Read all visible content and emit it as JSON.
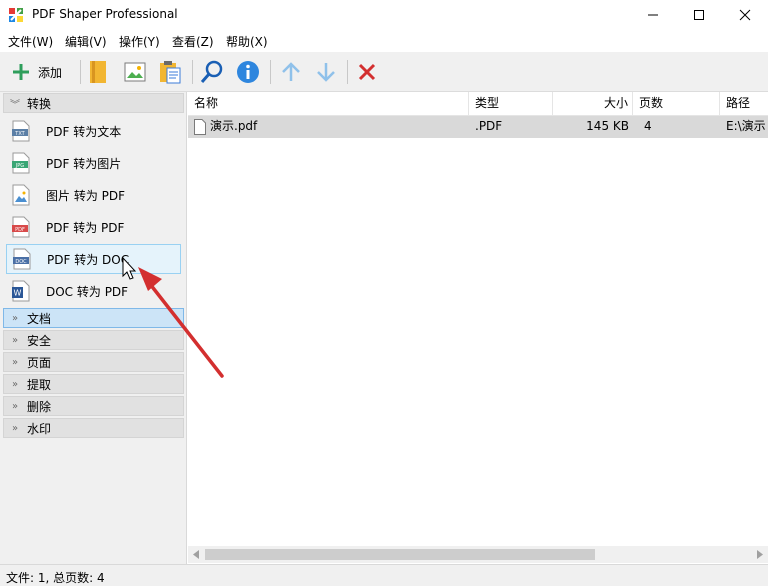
{
  "window": {
    "title": "PDF Shaper Professional",
    "minimize_icon": "minimize-icon",
    "maximize_icon": "maximize-icon",
    "close_icon": "close-icon"
  },
  "menu": [
    "文件(W)",
    "编辑(V)",
    "操作(Y)",
    "查看(Z)",
    "帮助(X)"
  ],
  "toolbar": {
    "add_label": "添加",
    "icons": [
      "plus-icon",
      "bookmark-icon",
      "image-icon",
      "clipboard-icon",
      "search-icon",
      "info-icon",
      "arrow-up-icon",
      "arrow-down-icon",
      "delete-icon"
    ]
  },
  "sidebar": {
    "open_section": "转换",
    "items": [
      {
        "label": "PDF 转为文本",
        "icon": "txt-file-icon",
        "badge": "TXT"
      },
      {
        "label": "PDF 转为图片",
        "icon": "jpg-file-icon",
        "badge": "JPG"
      },
      {
        "label": "图片 转为 PDF",
        "icon": "image-file-icon",
        "badge": ""
      },
      {
        "label": "PDF 转为 PDF",
        "icon": "pdf-file-icon",
        "badge": "PDF"
      },
      {
        "label": "PDF 转为 DOC",
        "icon": "doc-file-icon",
        "badge": "DOC"
      },
      {
        "label": "DOC 转为 PDF",
        "icon": "word-file-icon",
        "badge": "W"
      }
    ],
    "selected_item": "PDF 转为 DOC",
    "sections": [
      "文档",
      "安全",
      "页面",
      "提取",
      "删除",
      "水印"
    ],
    "highlighted_section": "文档"
  },
  "table": {
    "columns": [
      "名称",
      "类型",
      "大小",
      "页数",
      "路径"
    ],
    "rows": [
      {
        "name": "演示.pdf",
        "type": ".PDF",
        "size": "145 KB",
        "pages": "4",
        "path": "E:\\演示"
      }
    ]
  },
  "status": {
    "text": "文件: 1, 总页数: 4"
  },
  "colors": {
    "accent": "#2e86de",
    "selection": "#cce4f7",
    "row_selected": "#d9d9d9",
    "annotation_arrow": "#d32f2f"
  }
}
